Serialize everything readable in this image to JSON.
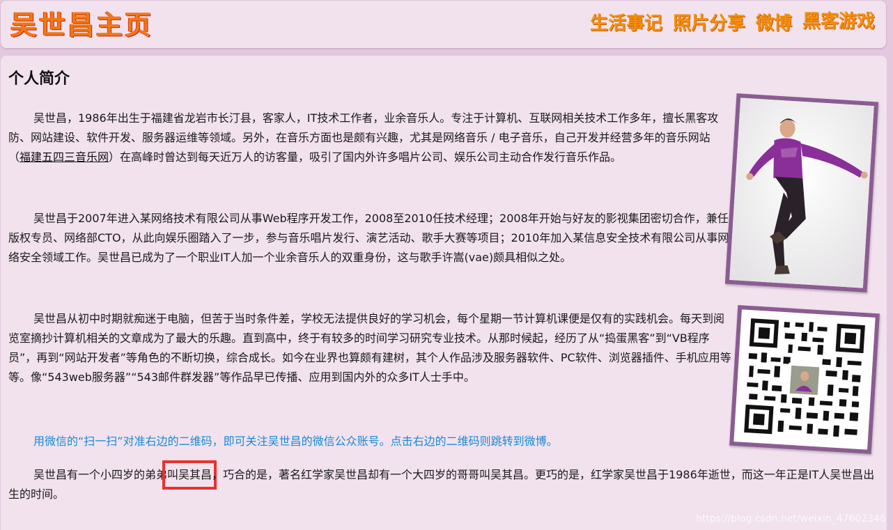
{
  "header": {
    "site_title": "吴世昌主页",
    "nav": [
      "生活事记",
      "照片分享",
      "微博",
      "黑客游戏"
    ]
  },
  "main": {
    "section_title": "个人简介",
    "p1": {
      "before_link": "吴世昌，1986年出生于福建省龙岩市长汀县，客家人，IT技术工作者，业余音乐人。专注于计算机、互联网相关技术工作多年，擅长黑客攻防、网站建设、软件开发、服务器运维等领域。另外，在音乐方面也是颇有兴趣，尤其是网络音乐 / 电子音乐，自己开发并经营多年的音乐网站（",
      "link": "福建五四三音乐网",
      "after_link": "）在高峰时曾达到每天近万人的访客量，吸引了国内外许多唱片公司、娱乐公司主动合作发行音乐作品。"
    },
    "p2": "吴世昌于2007年进入某网络技术有限公司从事Web程序开发工作，2008至2010任技术经理；2008年开始与好友的影视集团密切合作，兼任版权专员、网络部CTO，从此向娱乐圈踏入了一步，参与音乐唱片发行、演艺活动、歌手大赛等项目；2010年加入某信息安全技术有限公司从事网络安全领域工作。吴世昌已成为了一个职业IT人加一个业余音乐人的双重身份，这与歌手许嵩(vae)颇具相似之处。",
    "p3": "吴世昌从初中时期就痴迷于电脑，但苦于当时条件差，学校无法提供良好的学习机会，每个星期一节计算机课便是仅有的实践机会。每天到阅览室摘抄计算机相关的文章成为了最大的乐趣。直到高中，终于有较多的时间学习研究专业技术。从那时候起，经历了从“捣蛋黑客”到“VB程序员”，再到“网站开发者”等角色的不断切换，综合成长。如今在业界也算颇有建树，其个人作品涉及服务器软件、PC软件、浏览器插件、手机应用等等。像“543web服务器”“543邮件群发器”等作品早已传播、应用到国内外的众多IT人士手中。",
    "p4": "用微信的“扫一扫”对准右边的二维码，即可关注吴世昌的微信公众账号。点击右边的二维码则跳转到微博。",
    "p5": {
      "before": "吴世昌有一个小四岁的弟弟",
      "highlight": "叫吴其昌",
      "after": "，巧合的是，著名红学家吴世昌却有一个大四岁的哥哥叫吴其昌。更巧的是，红学家吴世昌于1986年逝世，而这一年正是IT人吴世昌出生的时间。"
    }
  },
  "watermark": "https://blog.csdn.net/weixin_47602346",
  "colors": {
    "page_bg": "#e3c8de",
    "panel_bg": "#f1e2ee",
    "title_orange": "#f07818",
    "nav_orange": "#f58e0b",
    "wechat_blue": "#1a8ad4",
    "frame_purple": "#8b5c92",
    "highlight_red": "#e8322e"
  },
  "images": {
    "profile_photo": "person-photo",
    "qr_code": "qr-code"
  }
}
